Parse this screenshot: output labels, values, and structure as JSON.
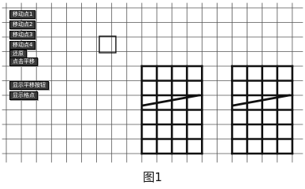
{
  "controls": {
    "buttons": [
      {
        "label": "移动点1"
      },
      {
        "label": "移动点2"
      },
      {
        "label": "移动点3"
      },
      {
        "label": "移动点4"
      },
      {
        "label": "还原"
      },
      {
        "label": "点击平移"
      },
      {
        "label": "显示平移按钮"
      },
      {
        "label": "显示格点"
      }
    ]
  },
  "figure": {
    "caption": "图1"
  },
  "colors": {
    "grid_line": "#555555",
    "figure_line": "#111111",
    "background": "#ffffff"
  }
}
